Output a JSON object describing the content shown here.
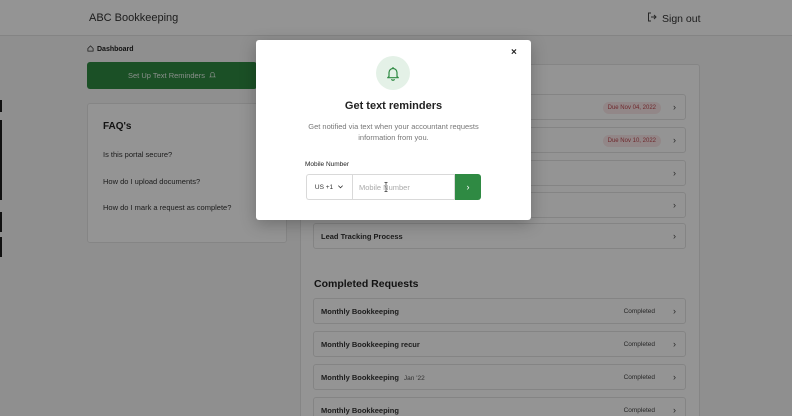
{
  "header": {
    "brand": "ABC Bookkeeping",
    "signout_label": "Sign out"
  },
  "breadcrumb": {
    "label": "Dashboard"
  },
  "reminder_button": {
    "label": "Set Up Text Reminders"
  },
  "faq": {
    "title": "FAQ's",
    "questions": [
      "Is this portal secure?",
      "How do I upload documents?",
      "How do I mark a request as complete?"
    ]
  },
  "open_requests": [
    {
      "title": "",
      "badge": "Due Nov 04, 2022"
    },
    {
      "title": "",
      "badge": "Due Nov 10, 2022"
    },
    {
      "title": "",
      "badge": ""
    },
    {
      "title": "",
      "badge": ""
    },
    {
      "title": "Lead Tracking Process",
      "badge": ""
    }
  ],
  "completed_section": {
    "title": "Completed Requests",
    "items": [
      {
        "title": "Monthly Bookkeeping",
        "sub": "",
        "status": "Completed"
      },
      {
        "title": "Monthly Bookkeeping recur",
        "sub": "",
        "status": "Completed"
      },
      {
        "title": "Monthly Bookkeeping",
        "sub": "Jan '22",
        "status": "Completed"
      },
      {
        "title": "Monthly Bookkeeping",
        "sub": "",
        "status": "Completed"
      }
    ]
  },
  "modal": {
    "title": "Get text reminders",
    "description": "Get notified via text when your accountant requests information from you.",
    "field_label": "Mobile Number",
    "country_code": "US +1",
    "phone_placeholder": "Mobile Number",
    "phone_value": "",
    "submit_icon": "chevron-right-icon",
    "close_icon": "close-icon"
  },
  "colors": {
    "brand_green": "#2f8a43",
    "due_badge_bg": "#fbe9ea",
    "due_badge_text": "#c0474f",
    "bell_bg": "#e4f1e7"
  }
}
